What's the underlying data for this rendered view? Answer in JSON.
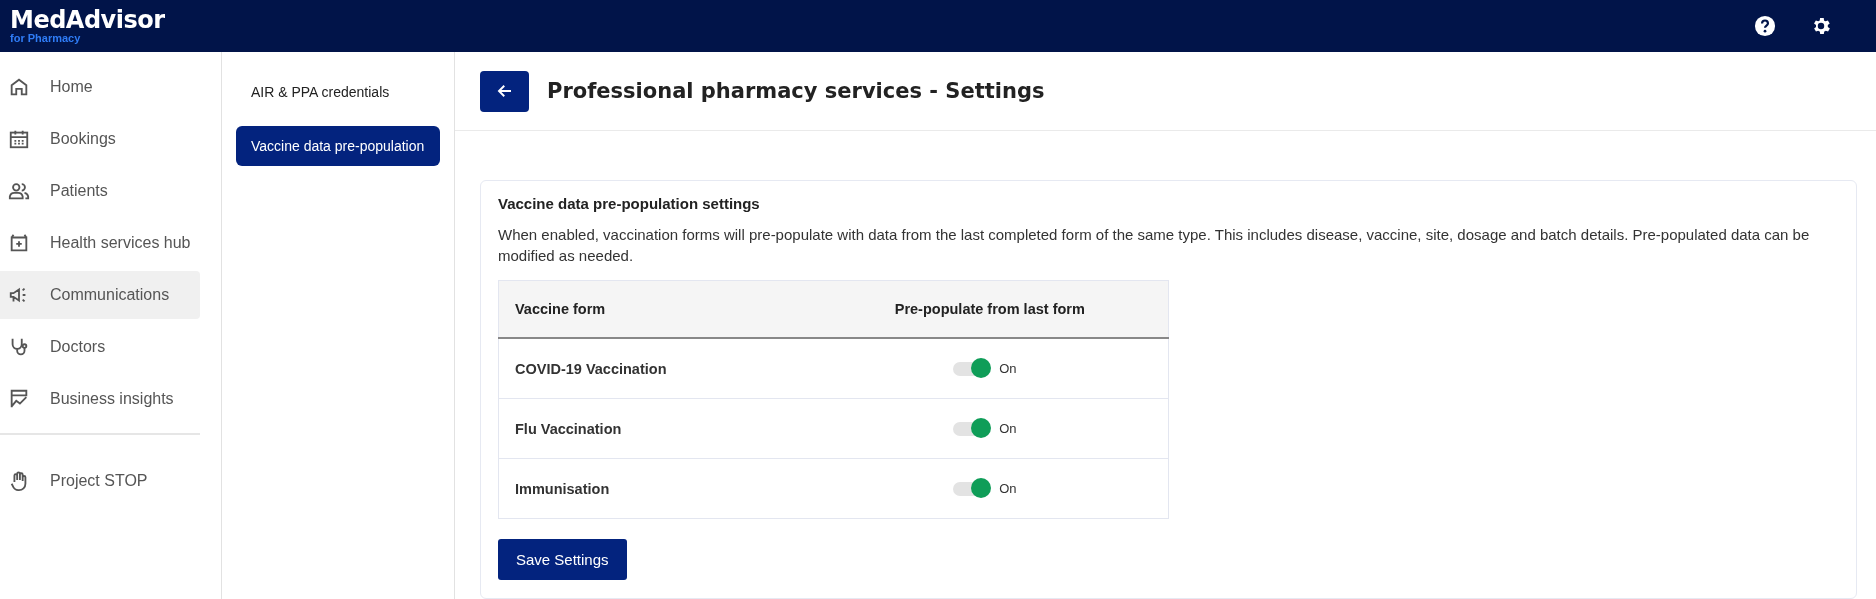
{
  "header": {
    "logo": "MedAdvisor",
    "logo_sub": "for Pharmacy"
  },
  "sidebar": {
    "groups": [
      {
        "items": [
          {
            "label": "Home",
            "selected": false
          },
          {
            "label": "Bookings",
            "selected": false
          },
          {
            "label": "Patients",
            "selected": false
          },
          {
            "label": "Health services hub",
            "selected": false
          },
          {
            "label": "Communications",
            "selected": true
          },
          {
            "label": "Doctors",
            "selected": false
          },
          {
            "label": "Business insights",
            "selected": false
          }
        ]
      },
      {
        "items": [
          {
            "label": "Project STOP",
            "selected": false
          }
        ]
      }
    ]
  },
  "subnav": {
    "items": [
      {
        "label": "AIR & PPA credentials",
        "selected": false
      },
      {
        "label": "Vaccine data pre-population",
        "selected": true
      }
    ]
  },
  "page": {
    "title": "Professional pharmacy services - Settings"
  },
  "card": {
    "title": "Vaccine data pre-population settings",
    "description": "When enabled, vaccination forms will pre-populate with data from the last completed form of the same type. This includes disease, vaccine, site, dosage and batch details. Pre-populated data can be modified as needed.",
    "table": {
      "columns": [
        "Vaccine form",
        "Pre-populate from last form"
      ],
      "rows": [
        {
          "form": "COVID-19 Vaccination",
          "on": true,
          "status": "On"
        },
        {
          "form": "Flu Vaccination",
          "on": true,
          "status": "On"
        },
        {
          "form": "Immunisation",
          "on": true,
          "status": "On"
        }
      ]
    },
    "save_button": "Save Settings"
  }
}
